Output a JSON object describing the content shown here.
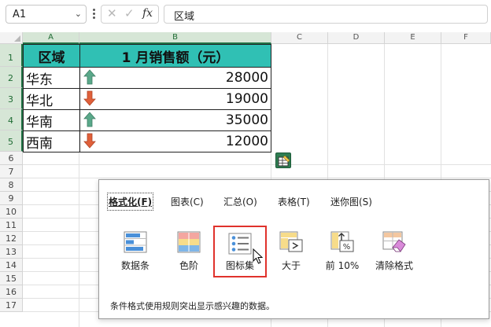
{
  "formula_bar": {
    "name_box": "A1",
    "chevron": "⌄",
    "cancel_glyph": "✕",
    "enter_glyph": "✓",
    "fx_glyph": "fx",
    "content": "区域"
  },
  "columns": [
    "A",
    "B",
    "C",
    "D",
    "E",
    "F"
  ],
  "rows": [
    "1",
    "2",
    "3",
    "4",
    "5",
    "6",
    "7",
    "8",
    "9",
    "10",
    "11",
    "12",
    "13",
    "14",
    "15",
    "16",
    "17"
  ],
  "table": {
    "header": [
      "区域",
      "1 月销售额（元）"
    ],
    "data": [
      {
        "region": "华东",
        "sales": "28000",
        "trend": "up"
      },
      {
        "region": "华北",
        "sales": "19000",
        "trend": "down"
      },
      {
        "region": "华南",
        "sales": "35000",
        "trend": "up"
      },
      {
        "region": "西南",
        "sales": "12000",
        "trend": "down"
      }
    ],
    "header_color": "#30c0b4",
    "up_color": "#5aa88a",
    "down_color": "#e0603a"
  },
  "quick_analysis": {
    "tabs": [
      "格式化(F)",
      "图表(C)",
      "汇总(O)",
      "表格(T)",
      "迷你图(S)"
    ],
    "active_tab": "格式化(F)",
    "options": [
      {
        "label": "数据条",
        "icon": "data-bars-icon"
      },
      {
        "label": "色阶",
        "icon": "color-scale-icon"
      },
      {
        "label": "图标集",
        "icon": "icon-set-icon"
      },
      {
        "label": "大于",
        "icon": "greater-than-icon"
      },
      {
        "label": "前 10%",
        "icon": "top-10-percent-icon"
      },
      {
        "label": "清除格式",
        "icon": "clear-format-icon"
      }
    ],
    "highlighted": "图标集",
    "hint": "条件格式使用规则突出显示感兴趣的数据。"
  }
}
